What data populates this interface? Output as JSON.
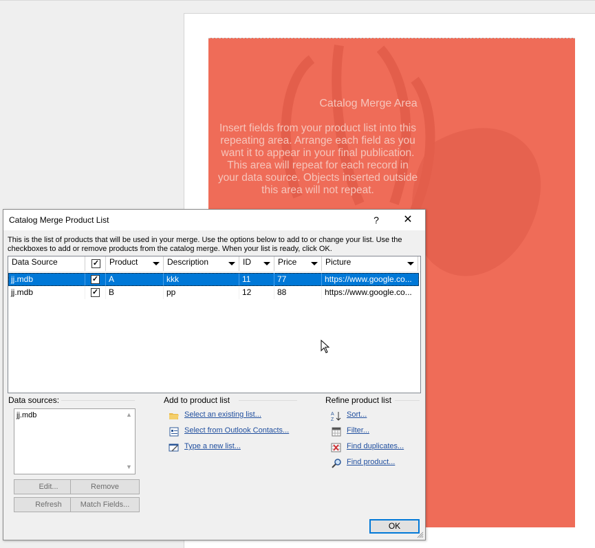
{
  "publication": {
    "merge_area_title": "Catalog Merge Area",
    "merge_area_text": "Insert fields from your product list into this\nrepeating area.  Arrange each field as you\nwant it to appear in your final publication.\nThis area will repeat for each record in\nyour data source.  Objects inserted outside\nthis area will not repeat.",
    "colors": {
      "merge_area": "#ef6c58",
      "watermark": "#e35e4b"
    }
  },
  "dialog": {
    "title": "Catalog Merge Product List",
    "help_label": "?",
    "close_label": "✕",
    "intro": "This is the list of products that will be used in your merge.  Use the options below to add to or change your list.  Use the checkboxes to add or remove products from the catalog merge.  When your list is ready, click OK.",
    "columns": [
      {
        "label": "Data Source",
        "has_dropdown": false
      },
      {
        "label": "",
        "is_checkbox": true
      },
      {
        "label": "Product",
        "has_dropdown": true
      },
      {
        "label": "Description",
        "has_dropdown": true
      },
      {
        "label": "ID",
        "has_dropdown": true
      },
      {
        "label": "Price",
        "has_dropdown": true
      },
      {
        "label": "Picture",
        "has_dropdown": true
      }
    ],
    "rows": [
      {
        "source": "jj.mdb",
        "checked": true,
        "product": "A",
        "description": "kkk",
        "id": "11",
        "price": "77",
        "picture": "https://www.google.co...",
        "selected": true
      },
      {
        "source": "jj.mdb",
        "checked": true,
        "product": "B",
        "description": "pp",
        "id": "12",
        "price": "88",
        "picture": "https://www.google.co...",
        "selected": false
      }
    ],
    "data_sources": {
      "label": "Data sources:",
      "items": [
        "jj.mdb"
      ],
      "buttons": {
        "edit": "Edit...",
        "remove": "Remove",
        "refresh": "Refresh",
        "match_fields": "Match Fields..."
      }
    },
    "add_to_list": {
      "label": "Add to product list",
      "links": [
        {
          "label": "Select an existing list...",
          "icon": "folder-icon"
        },
        {
          "label": "Select from Outlook Contacts...",
          "icon": "contacts-icon"
        },
        {
          "label": "Type a new list...",
          "icon": "new-list-icon"
        }
      ]
    },
    "refine_list": {
      "label": "Refine product list",
      "links": [
        {
          "label": "Sort...",
          "icon": "sort-icon"
        },
        {
          "label": "Filter...",
          "icon": "filter-icon"
        },
        {
          "label": "Find duplicates...",
          "icon": "find-duplicates-icon"
        },
        {
          "label": "Find product...",
          "icon": "find-icon"
        }
      ]
    },
    "ok_label": "OK",
    "colors": {
      "selection": "#0078d7",
      "link": "#1f4e9e"
    }
  }
}
